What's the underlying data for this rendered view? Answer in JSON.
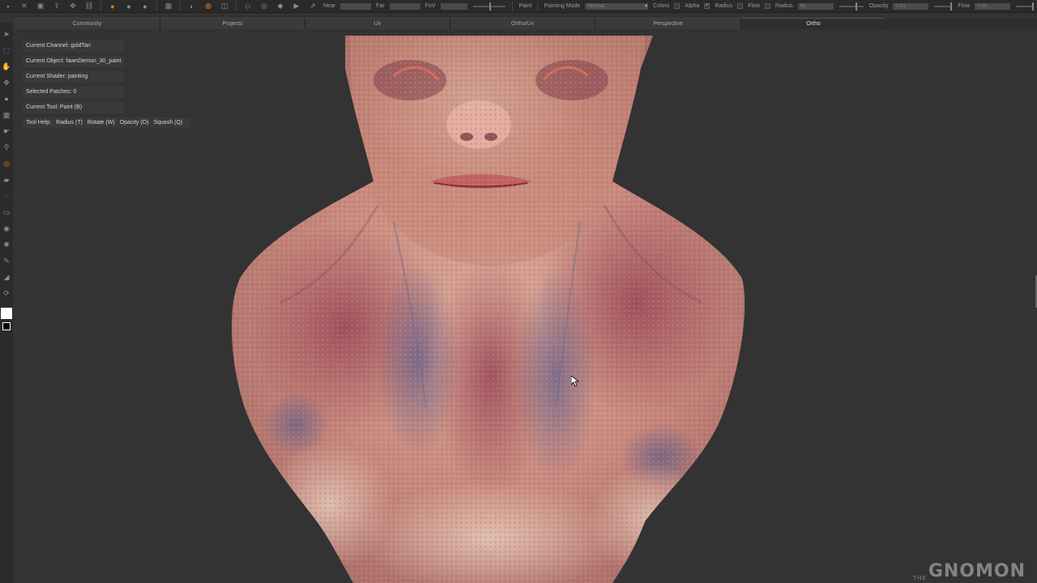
{
  "toolbar": {
    "near_label": "Near",
    "far_label": "Far",
    "fov_label": "FoV",
    "paint_label": "Paint",
    "painting_mode_label": "Painting Mode",
    "painting_mode_value": "Normal",
    "colors_label": "Colors",
    "alpha_label": "Alpha",
    "radius_label": "Radius",
    "flow_label": "Flow",
    "radius2_label": "Radius",
    "radius_value": "66",
    "opacity_label": "Opacity",
    "opacity_value": "0.63",
    "flow2_label": "Flow",
    "flow_value": "0.46"
  },
  "tabs": [
    {
      "label": "Community"
    },
    {
      "label": "Projects"
    },
    {
      "label": "Uv"
    },
    {
      "label": "Ortho/Uv"
    },
    {
      "label": "Perspective"
    },
    {
      "label": "Ortho"
    }
  ],
  "hud": {
    "current_channel": "Current Channel: goldTan",
    "current_object": "Current Object: fawnDemon_30_paint",
    "current_shader": "Current Shader: painting",
    "selected_patches": "Selected Patches: 0",
    "current_tool": "Current Tool: Paint (B)",
    "tool_help": "Tool Help:",
    "help_radius": "Radius (T)",
    "help_rotate": "Rotate (W)",
    "help_opacity": "Opacity (O)",
    "help_squash": "Squash (Q)"
  },
  "watermark": {
    "prefix": "THE",
    "text": "GNOMON"
  },
  "colors": {
    "accent": "#e07a1a",
    "background": "#333333",
    "foreground_swatch": "#ffffff",
    "background_swatch": "#000000"
  },
  "icons": [
    "select-icon",
    "transform-icon",
    "move-icon",
    "paint-icon",
    "grid-icon",
    "smear-icon",
    "pin-icon",
    "target-icon",
    "eraser-icon",
    "clone-icon",
    "gradient-icon",
    "stamp-icon",
    "blur-icon",
    "eyedropper-icon",
    "fill-icon",
    "refresh-icon"
  ]
}
